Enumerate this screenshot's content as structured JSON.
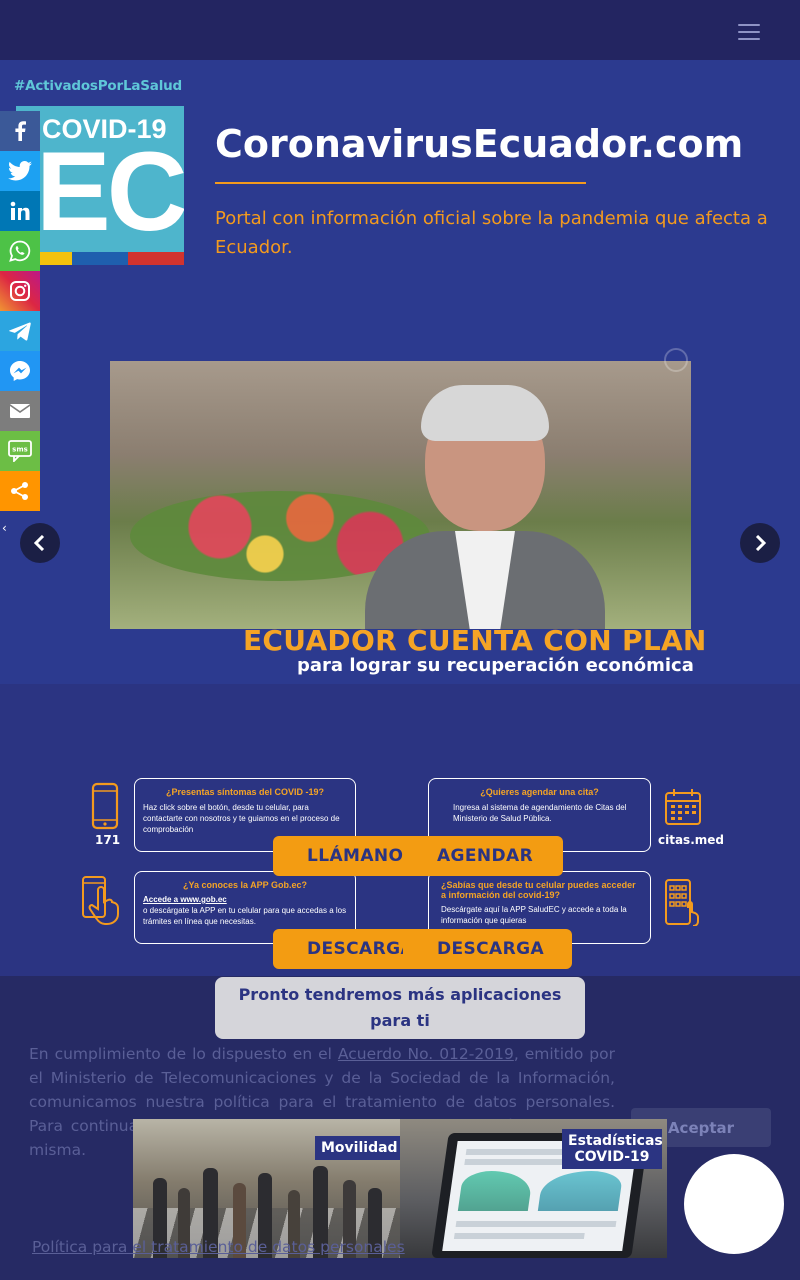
{
  "header": {
    "menu_icon": "hamburger-menu-icon"
  },
  "logo": {
    "hashtag": "#ActivadosPorLaSalud",
    "line1": "COVID-19",
    "line2": "EC",
    "flag_colors": [
      "#f4c20d",
      "#1f5fae",
      "#d1332e"
    ]
  },
  "site": {
    "title": "CoronavirusEcuador.com",
    "subtitle": "Portal con información oficial sobre la pandemia que afecta a Ecuador."
  },
  "social": {
    "items": [
      {
        "name": "facebook",
        "icon": "facebook-icon",
        "color": "#3b5998"
      },
      {
        "name": "twitter",
        "icon": "twitter-icon",
        "color": "#1da1f2"
      },
      {
        "name": "linkedin",
        "icon": "linkedin-icon",
        "color": "#0077b5"
      },
      {
        "name": "whatsapp",
        "icon": "whatsapp-icon",
        "color": "#4dc247"
      },
      {
        "name": "instagram",
        "icon": "instagram-icon",
        "color": "#c13584"
      },
      {
        "name": "telegram",
        "icon": "telegram-icon",
        "color": "#2ca5e0"
      },
      {
        "name": "messenger",
        "icon": "messenger-icon",
        "color": "#2196f3"
      },
      {
        "name": "email",
        "icon": "email-icon",
        "color": "#7d7d7d"
      },
      {
        "name": "sms",
        "icon": "sms-icon",
        "color": "#6cbe45"
      },
      {
        "name": "share",
        "icon": "share-icon",
        "color": "#ff9500"
      }
    ],
    "hide_label": "‹"
  },
  "carousel": {
    "headline": "ECUADOR CUENTA CON PLAN",
    "subline": "para lograr su recuperación económica"
  },
  "services": [
    {
      "title": "¿Presentas síntomas del COVID -19?",
      "text": "Haz click sobre el botón, desde tu celular, para contactarte con nosotros y te guiamos en el proceso de comprobación",
      "icon": "smartphone-icon",
      "icon_label": "171"
    },
    {
      "title": "¿Quieres agendar una cita?",
      "text": "Ingresa al sistema de agendamiento de Citas del Ministerio de Salud Pública.",
      "icon": "calendar-icon",
      "icon_label": "citas.med"
    },
    {
      "title": "¿Ya conoces la APP Gob.ec?",
      "link": "Accede a www.gob.ec",
      "text": "o descárgate la APP en tu celular para que accedas a los trámites en línea que necesitas.",
      "icon": "phone-touch-icon"
    },
    {
      "title": "¿Sabías que desde tu celular puedes acceder a información del covid-19?",
      "text": "Descárgate aquí la APP SaludEC y accede a toda la información que quieras",
      "icon": "mobile-grid-icon"
    }
  ],
  "buttons": {
    "row1_left": "LLÁMANOS",
    "row1_right": "AGENDAR",
    "row2_left": "DESCARGA",
    "row2_right": "DESCARGA"
  },
  "notice": {
    "pronto": "Pronto tendremos más aplicaciones para ti"
  },
  "consent": {
    "part1": "En cumplimiento de lo dispuesto en el ",
    "link": "Acuerdo No. 012-2019",
    "part2": ", emitido por el Ministerio de Telecomunicaciones y de la Sociedad de la Información, comunicamos nuestra política para el tratamiento de datos personales. Para continuar navegando en este sitio debe aceptar los términos de la misma.",
    "accept": "Aceptar",
    "policy_link": "Política para el tratamiento de datos personales"
  },
  "thumbs": [
    {
      "label": "Movilidad"
    },
    {
      "label": "Estadísticas COVID-19"
    }
  ]
}
